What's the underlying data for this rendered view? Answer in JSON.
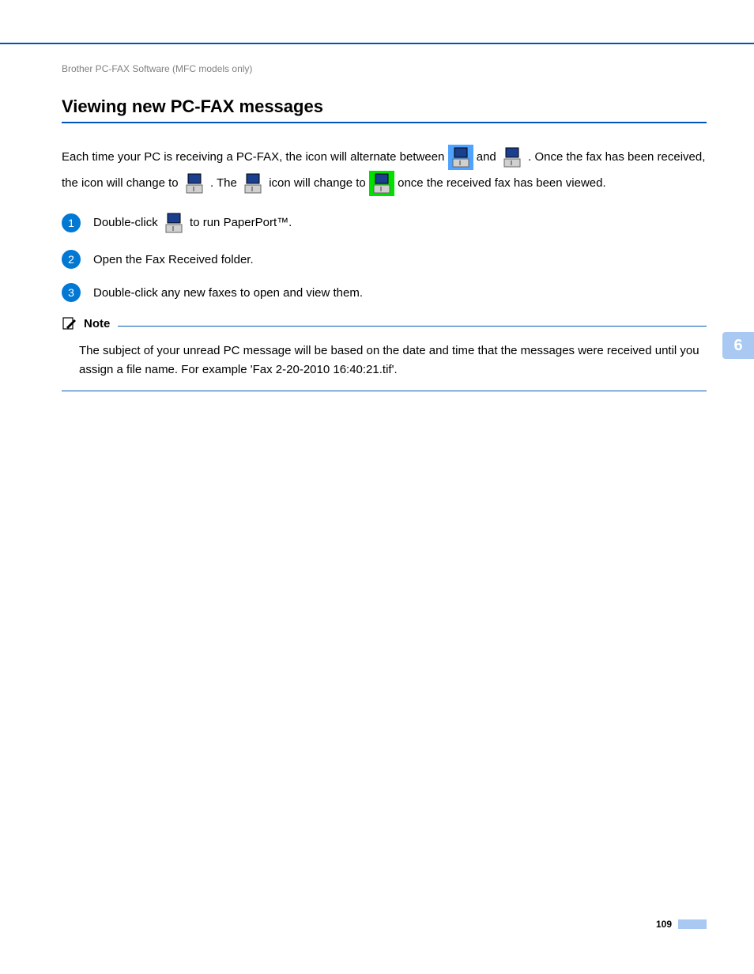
{
  "breadcrumb": "Brother PC-FAX Software (MFC models only)",
  "section_title": "Viewing new PC-FAX messages",
  "para": {
    "t1": "Each time your PC is receiving a PC-FAX, the icon will alternate between ",
    "t2": " and ",
    "t3": ". Once the fax has been received, the icon will change to ",
    "t4": ". The ",
    "t5": " icon will change to ",
    "t6": " once the received fax has been viewed."
  },
  "steps": {
    "s1a": "Double-click ",
    "s1b": " to run PaperPort™.",
    "s2": "Open the Fax Received folder.",
    "s3": "Double-click any new faxes to open and view them."
  },
  "note": {
    "label": "Note",
    "body": "The subject of your unread PC message will be based on the date and time that the messages were received until you assign a file name. For example 'Fax 2-20-2010 16:40:21.tif'."
  },
  "chapter": "6",
  "page_number": "109"
}
